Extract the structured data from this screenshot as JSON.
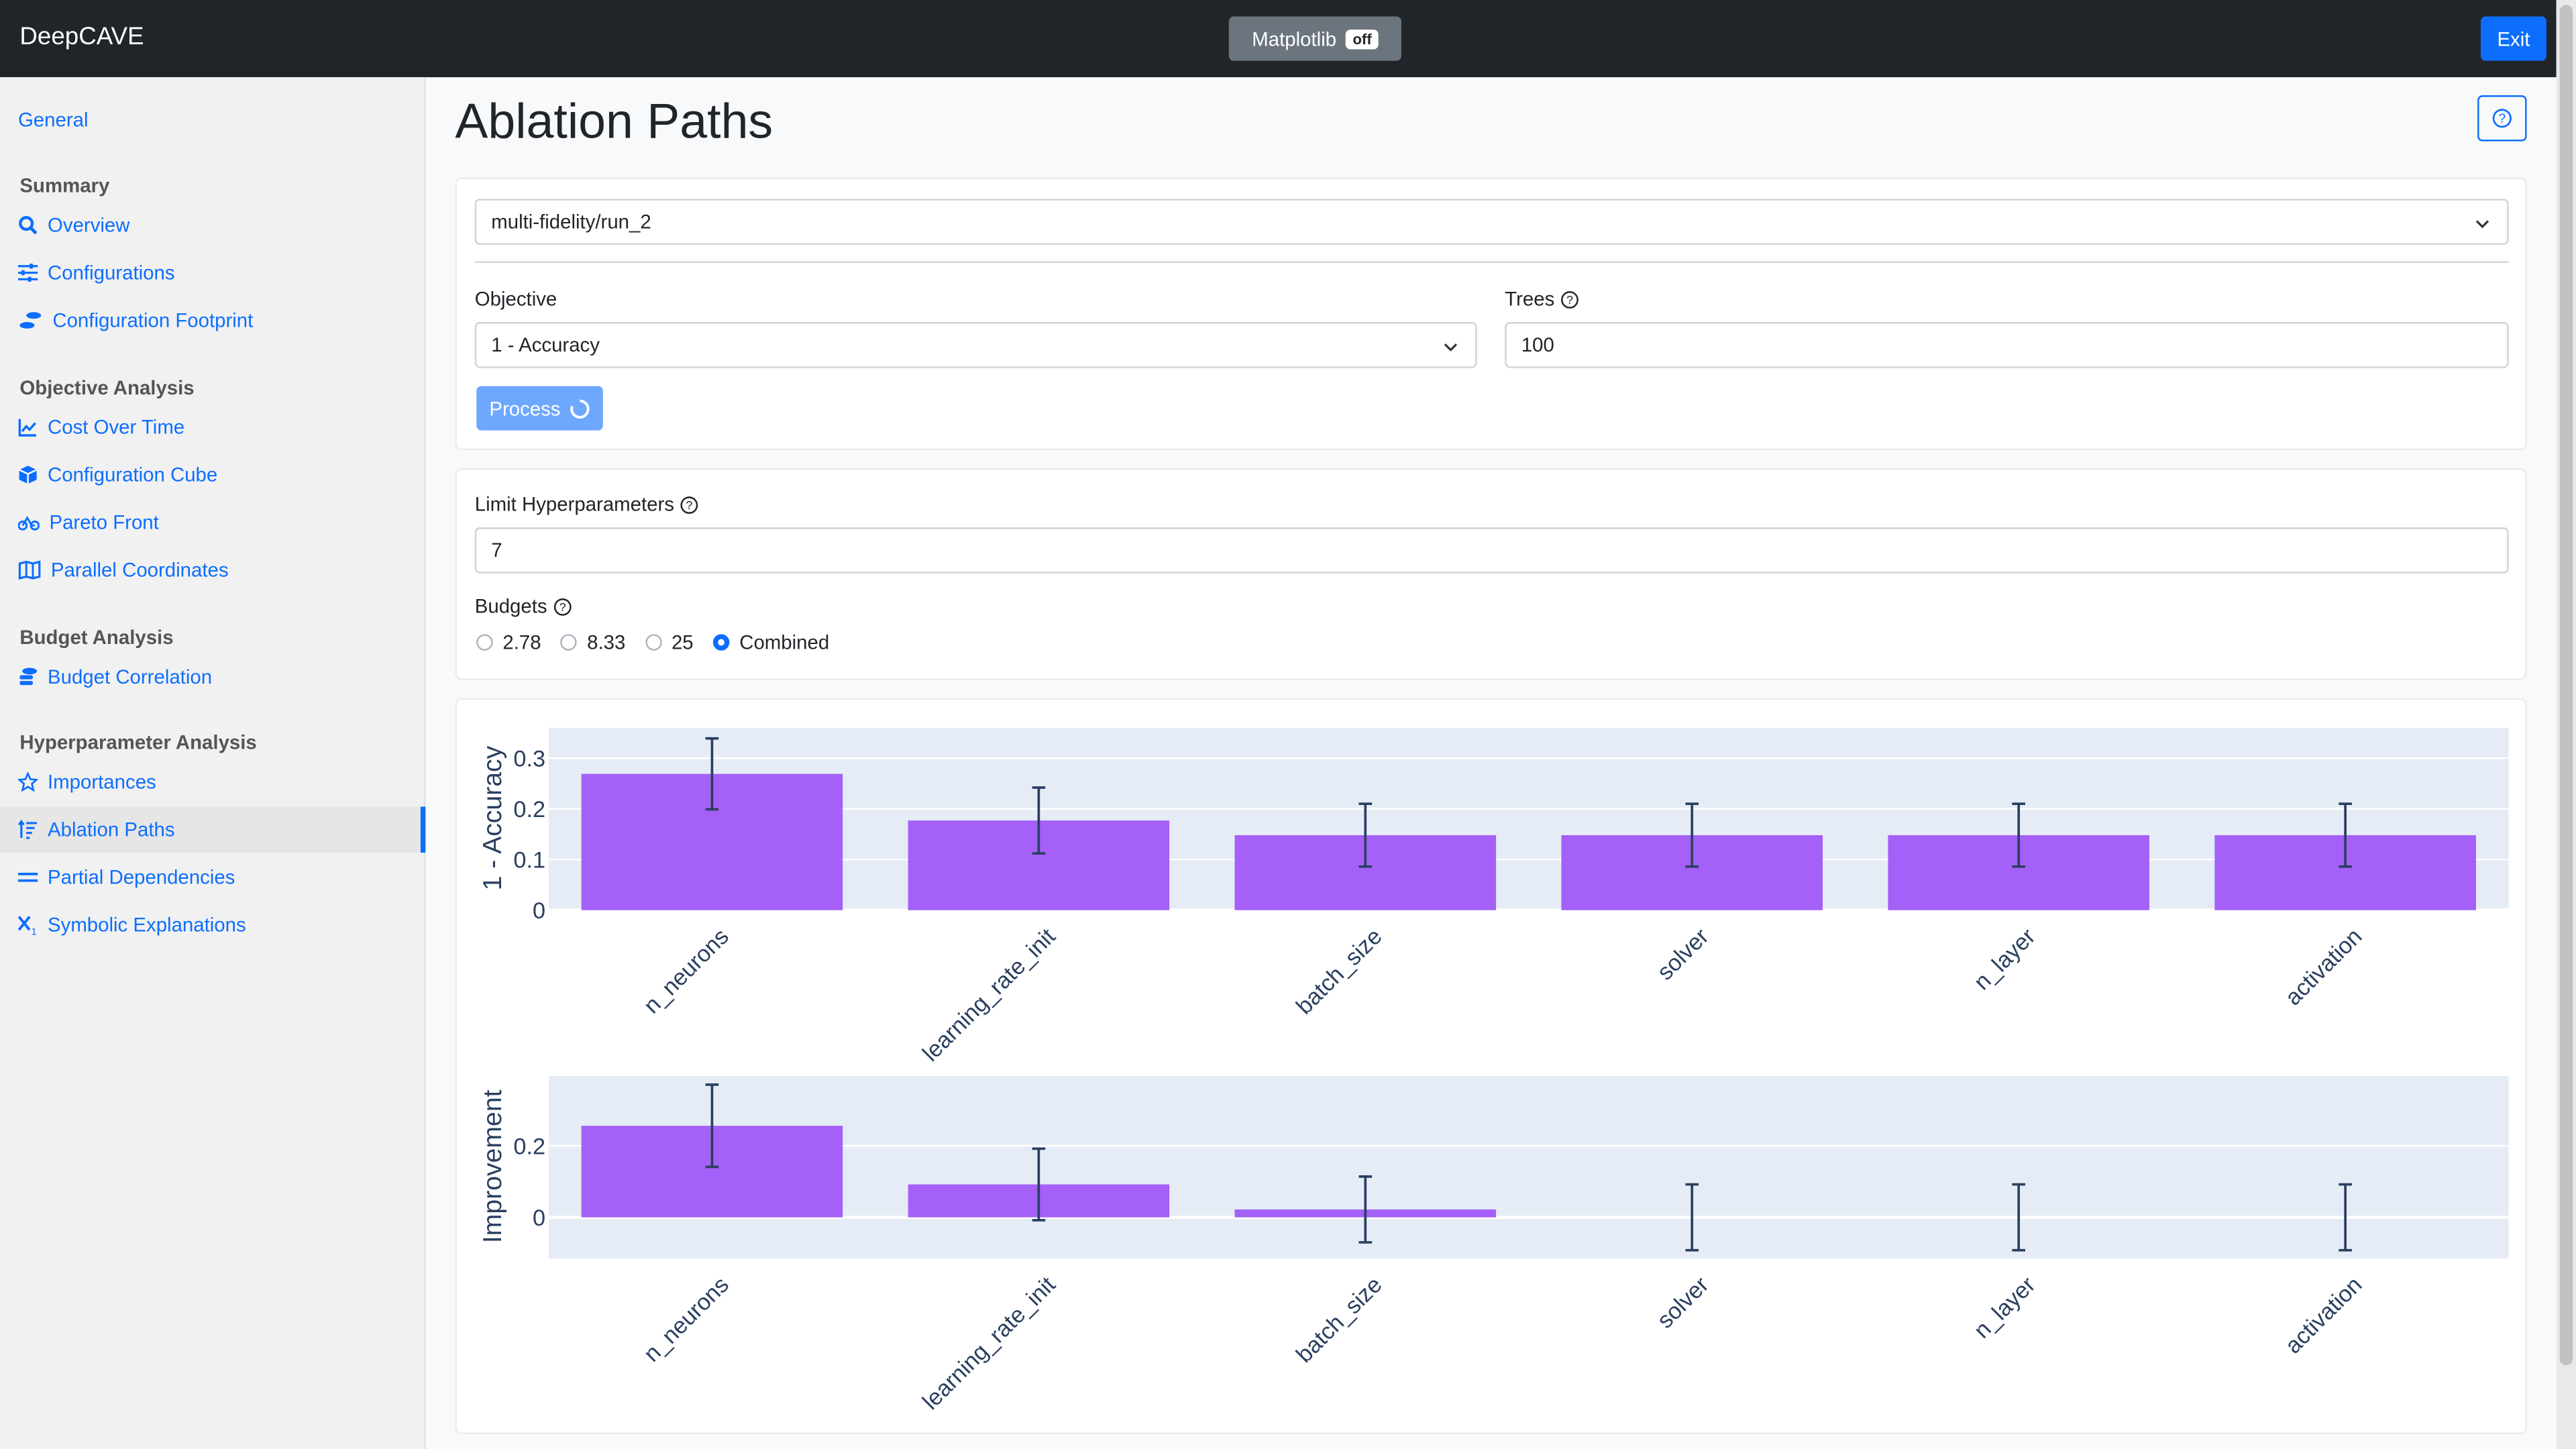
{
  "header": {
    "brand": "DeepCAVE",
    "matplotlib_label": "Matplotlib",
    "matplotlib_state": "off",
    "exit_label": "Exit"
  },
  "sidebar": {
    "general": "General",
    "sections": [
      {
        "title": "Summary",
        "items": [
          "Overview",
          "Configurations",
          "Configuration Footprint"
        ]
      },
      {
        "title": "Objective Analysis",
        "items": [
          "Cost Over Time",
          "Configuration Cube",
          "Pareto Front",
          "Parallel Coordinates"
        ]
      },
      {
        "title": "Budget Analysis",
        "items": [
          "Budget Correlation"
        ]
      },
      {
        "title": "Hyperparameter Analysis",
        "items": [
          "Importances",
          "Ablation Paths",
          "Partial Dependencies",
          "Symbolic Explanations"
        ]
      }
    ],
    "active": "Ablation Paths"
  },
  "page": {
    "title": "Ablation Paths"
  },
  "run_select": {
    "value": "multi-fidelity/run_2"
  },
  "objective": {
    "label": "Objective",
    "value": "1 - Accuracy"
  },
  "trees": {
    "label": "Trees",
    "value": "100"
  },
  "process": {
    "label": "Process"
  },
  "limit": {
    "label": "Limit Hyperparameters",
    "value": "7"
  },
  "budgets": {
    "label": "Budgets",
    "options": [
      "2.78",
      "8.33",
      "25",
      "Combined"
    ],
    "selected": "Combined"
  },
  "colors": {
    "bar": "#a560f7",
    "plot_bg": "#e5ecf6",
    "accent": "#0d6efd"
  },
  "chart_data": [
    {
      "type": "bar",
      "categories": [
        "n_neurons",
        "learning_rate_init",
        "batch_size",
        "solver",
        "n_layer",
        "activation"
      ],
      "values": [
        0.269,
        0.177,
        0.148,
        0.148,
        0.148,
        0.148
      ],
      "error": [
        0.07,
        0.065,
        0.062,
        0.062,
        0.062,
        0.062
      ],
      "ylabel": "1 - Accuracy",
      "yticks": [
        0,
        0.1,
        0.2,
        0.3
      ],
      "ylim": [
        0,
        0.36
      ],
      "grid": true
    },
    {
      "type": "bar",
      "categories": [
        "n_neurons",
        "learning_rate_init",
        "batch_size",
        "solver",
        "n_layer",
        "activation"
      ],
      "values": [
        0.256,
        0.092,
        0.022,
        0,
        0,
        0
      ],
      "error": [
        0.115,
        0.1,
        0.092,
        0.092,
        0.092,
        0.092
      ],
      "ylabel": "Improvement",
      "yticks": [
        0,
        0.2
      ],
      "ylim": [
        -0.115,
        0.395
      ],
      "grid": true
    }
  ]
}
